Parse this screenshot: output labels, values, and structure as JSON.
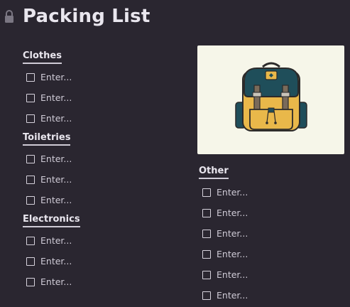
{
  "page": {
    "title": "Packing List",
    "lock_icon": "lock-icon"
  },
  "sections": {
    "clothes": {
      "heading": "Clothes",
      "items": [
        "Enter...",
        "Enter...",
        "Enter..."
      ]
    },
    "toiletries": {
      "heading": "Toiletries",
      "items": [
        "Enter...",
        "Enter...",
        "Enter..."
      ]
    },
    "electronics": {
      "heading": "Electronics",
      "items": [
        "Enter...",
        "Enter...",
        "Enter..."
      ]
    },
    "other": {
      "heading": "Other",
      "items": [
        "Enter...",
        "Enter...",
        "Enter...",
        "Enter...",
        "Enter...",
        "Enter..."
      ]
    }
  },
  "image": {
    "subject": "backpack illustration"
  },
  "colors": {
    "background": "#2a2630",
    "text": "#e6e3ea",
    "card": "#f6f6e9"
  }
}
